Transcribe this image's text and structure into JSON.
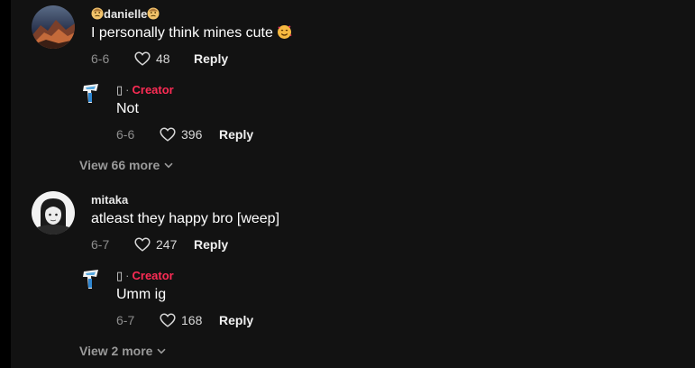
{
  "comments": [
    {
      "username": "danielle",
      "username_emoji": "pensive-face-emoji",
      "text": "I personally think mines cute ",
      "text_emoji": "smiling-face-with-hearts-emoji",
      "date": "6-6",
      "likes": "48",
      "reply_label": "Reply",
      "reply": {
        "username": "▯",
        "separator": "·",
        "creator_label": "Creator",
        "text": "Not",
        "date": "6-6",
        "likes": "396",
        "reply_label": "Reply"
      },
      "view_more": "View 66 more"
    },
    {
      "username": "mitaka",
      "text": "atleast they happy bro [weep]",
      "date": "6-7",
      "likes": "247",
      "reply_label": "Reply",
      "reply": {
        "username": "▯",
        "separator": "·",
        "creator_label": "Creator",
        "text": "Umm ig",
        "date": "6-7",
        "likes": "168",
        "reply_label": "Reply"
      },
      "view_more": "View 2 more"
    }
  ],
  "colors": {
    "background": "#121212",
    "creator": "#fe2c55",
    "muted": "#8e8e8e"
  },
  "icons": {
    "like": "heart-outline-icon",
    "expand": "chevron-down-icon"
  }
}
